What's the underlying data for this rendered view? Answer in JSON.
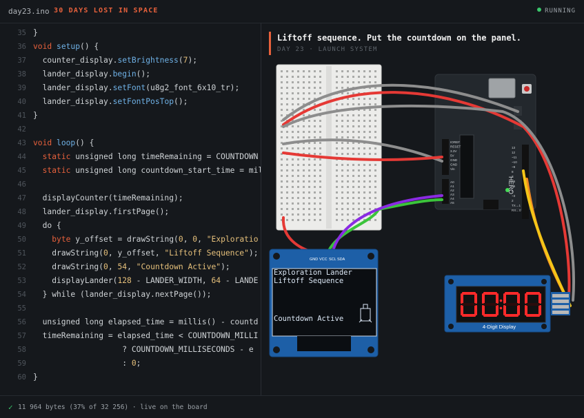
{
  "topbar": {
    "filename": "day23.ino",
    "project_title": "30 DAYS LOST IN SPACE",
    "status": "RUNNING"
  },
  "code": [
    {
      "n": "35",
      "t": [
        [
          "p",
          "}"
        ]
      ]
    },
    {
      "n": "36",
      "t": [
        [
          "kw",
          "void "
        ],
        [
          "fn",
          "setup"
        ],
        [
          "p",
          "() {"
        ]
      ]
    },
    {
      "n": "37",
      "t": [
        [
          "p",
          "  counter_display."
        ],
        [
          "fn",
          "setBrightness"
        ],
        [
          "p",
          "("
        ],
        [
          "num",
          "7"
        ],
        [
          "p",
          ");"
        ]
      ]
    },
    {
      "n": "38",
      "t": [
        [
          "p",
          "  lander_display."
        ],
        [
          "fn",
          "begin"
        ],
        [
          "p",
          "();"
        ]
      ]
    },
    {
      "n": "39",
      "t": [
        [
          "p",
          "  lander_display."
        ],
        [
          "fn",
          "setFont"
        ],
        [
          "p",
          "(u8g2_font_6x10_tr);"
        ]
      ]
    },
    {
      "n": "40",
      "t": [
        [
          "p",
          "  lander_display."
        ],
        [
          "fn",
          "setFontPosTop"
        ],
        [
          "p",
          "();"
        ]
      ]
    },
    {
      "n": "41",
      "t": [
        [
          "p",
          "}"
        ]
      ]
    },
    {
      "n": "42",
      "t": []
    },
    {
      "n": "43",
      "t": [
        [
          "kw",
          "void "
        ],
        [
          "fn",
          "loop"
        ],
        [
          "p",
          "() {"
        ]
      ]
    },
    {
      "n": "44",
      "t": [
        [
          "p",
          "  "
        ],
        [
          "kw",
          "static "
        ],
        [
          "p",
          "unsigned long timeRemaining = COUNTDOWN"
        ]
      ]
    },
    {
      "n": "45",
      "t": [
        [
          "p",
          "  "
        ],
        [
          "kw",
          "static "
        ],
        [
          "p",
          "unsigned long countdown_start_time = mil"
        ]
      ]
    },
    {
      "n": "46",
      "t": []
    },
    {
      "n": "47",
      "t": [
        [
          "p",
          "  displayCounter(timeRemaining);"
        ]
      ]
    },
    {
      "n": "48",
      "t": [
        [
          "p",
          "  lander_display.firstPage();"
        ]
      ]
    },
    {
      "n": "49",
      "t": [
        [
          "p",
          "  do {"
        ]
      ]
    },
    {
      "n": "50",
      "t": [
        [
          "p",
          "    "
        ],
        [
          "ty",
          "byte "
        ],
        [
          "p",
          "y_offset = drawString("
        ],
        [
          "num",
          "0"
        ],
        [
          "p",
          ", "
        ],
        [
          "num",
          "0"
        ],
        [
          "p",
          ", "
        ],
        [
          "str",
          "\"Exploratio"
        ]
      ]
    },
    {
      "n": "51",
      "t": [
        [
          "p",
          "    drawString("
        ],
        [
          "num",
          "0"
        ],
        [
          "p",
          ", y_offset, "
        ],
        [
          "str",
          "\"Liftoff Sequence\""
        ],
        [
          "p",
          ");"
        ]
      ]
    },
    {
      "n": "52",
      "t": [
        [
          "p",
          "    drawString("
        ],
        [
          "num",
          "0"
        ],
        [
          "p",
          ", "
        ],
        [
          "num",
          "54"
        ],
        [
          "p",
          ", "
        ],
        [
          "str",
          "\"Countdown Active\""
        ],
        [
          "p",
          ");"
        ]
      ]
    },
    {
      "n": "53",
      "t": [
        [
          "p",
          "    displayLander("
        ],
        [
          "num",
          "128"
        ],
        [
          "p",
          " - LANDER_WIDTH, "
        ],
        [
          "num",
          "64"
        ],
        [
          "p",
          " - LANDE"
        ]
      ]
    },
    {
      "n": "54",
      "t": [
        [
          "p",
          "  } while (lander_display.nextPage());"
        ]
      ]
    },
    {
      "n": "55",
      "t": []
    },
    {
      "n": "56",
      "t": [
        [
          "p",
          "  unsigned long elapsed_time = millis() - countd"
        ]
      ]
    },
    {
      "n": "57",
      "t": [
        [
          "p",
          "  timeRemaining = elapsed_time < COUNTDOWN_MILLI"
        ]
      ]
    },
    {
      "n": "58",
      "t": [
        [
          "p",
          "                   ? COUNTDOWN_MILLISECONDS - e"
        ]
      ]
    },
    {
      "n": "59",
      "t": [
        [
          "p",
          "                   : "
        ],
        [
          "num",
          "0"
        ],
        [
          "p",
          ";"
        ]
      ]
    },
    {
      "n": "60",
      "t": [
        [
          "p",
          "}"
        ]
      ]
    }
  ],
  "task": {
    "title": "Liftoff sequence. Put the countdown on the panel.",
    "subtitle": "DAY 23 · LAUNCH SYSTEM"
  },
  "oled": {
    "pins": [
      "GND",
      "VCC",
      "SCL",
      "SDA"
    ],
    "lines": [
      "Exploration Lander",
      "Liftoff Sequence"
    ],
    "bottom_line": "Countdown Active"
  },
  "segment_display": {
    "digits": "0000",
    "label": "4-Digit Display"
  },
  "arduino": {
    "label": "HERO",
    "left_pins": [
      "IOREF",
      "RESET",
      "3.3V",
      "5V",
      "GND",
      "GND",
      "Vin"
    ],
    "analog_pins": [
      "A0",
      "A1",
      "A2",
      "A3",
      "A4",
      "A5"
    ],
    "right_pins": [
      "13",
      "12",
      "~11",
      "~10",
      "~9",
      "8",
      "7",
      "~6",
      "~5",
      "4",
      "~3",
      "2",
      "TX→1",
      "RX←0"
    ]
  },
  "footer": {
    "check": "✓",
    "text": "11 964 bytes (37% of 32 256) · live on the board"
  },
  "colors": {
    "accent": "#e8613c",
    "running": "#3ac66b",
    "wire_red": "#e53935",
    "wire_gray": "#8d8d8d",
    "wire_green": "#3bc43b",
    "wire_purple": "#8a2be2",
    "wire_yellow": "#f5c518",
    "wire_orange": "#f08a24"
  }
}
